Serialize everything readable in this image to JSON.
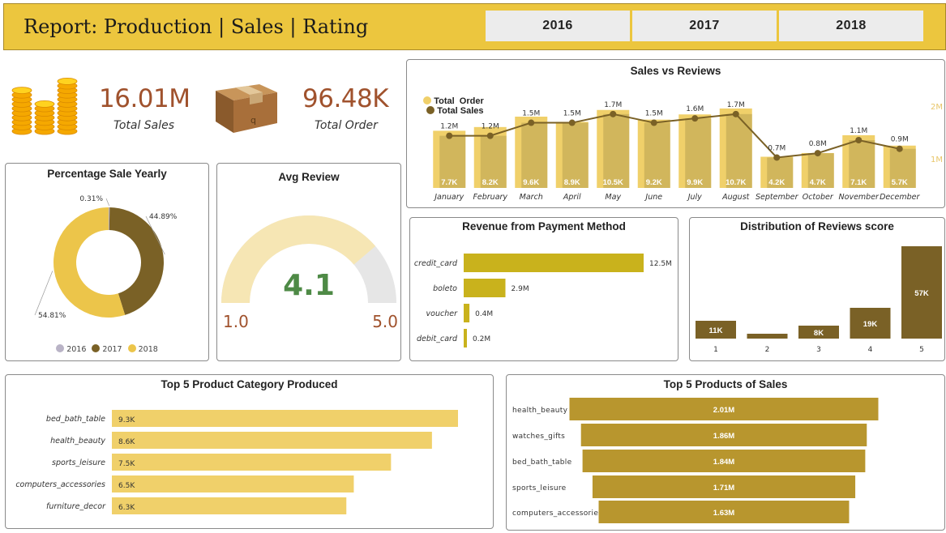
{
  "header": {
    "title": "Report: Production | Sales | Rating",
    "years": [
      "2016",
      "2017",
      "2018"
    ]
  },
  "kpis": {
    "total_sales_value": "16.01M",
    "total_sales_label": "Total Sales",
    "total_order_value": "96.48K",
    "total_order_label": "Total Order"
  },
  "colors": {
    "header_bg": "#ecc63e",
    "kpi_value": "#a0522d",
    "gold_light": "#f0d06a",
    "olive_dark": "#7a6126",
    "mustard": "#c9b21c",
    "gold_mid": "#b8962e",
    "gauge_fill": "#f6e6b4",
    "gauge_rest": "#e6e6e6",
    "gauge_value": "#4e8a46"
  },
  "pie": {
    "title": "Percentage Sale Yearly",
    "legend": [
      "2016",
      "2017",
      "2018"
    ],
    "legend_colors": [
      "#b9b3c6",
      "#7a6126",
      "#ecc54a"
    ]
  },
  "gauge": {
    "title": "Avg Review",
    "value": "4.1",
    "min": "1.0",
    "max": "5.0"
  },
  "sales_reviews": {
    "title": "Sales vs Reviews",
    "legend_order": "Total  Order",
    "legend_sales": "Total Sales",
    "right_axis_ticks": [
      "2M",
      "1M"
    ]
  },
  "payment": {
    "title": "Revenue from Payment Method"
  },
  "reviews_dist": {
    "title": "Distribution of Reviews score"
  },
  "categories_produced": {
    "title": "Top 5 Product Category Produced"
  },
  "products_sales": {
    "title": "Top 5 Products of Sales"
  },
  "chart_data": [
    {
      "id": "pie",
      "type": "pie",
      "title": "Percentage Sale Yearly",
      "labels": [
        "2016",
        "2017",
        "2018"
      ],
      "values": [
        0.31,
        44.89,
        54.81
      ],
      "value_labels": [
        "0.31%",
        "44.89%",
        "54.81%"
      ],
      "legend": "bottom"
    },
    {
      "id": "sales_reviews",
      "type": "bar",
      "title": "Sales vs Reviews",
      "categories": [
        "January",
        "February",
        "March",
        "April",
        "May",
        "June",
        "July",
        "August",
        "September",
        "October",
        "November",
        "December"
      ],
      "series": [
        {
          "name": "Total  Order",
          "type": "bar",
          "values": [
            7.7,
            8.2,
            9.6,
            8.9,
            10.5,
            9.2,
            9.9,
            10.7,
            4.2,
            4.7,
            7.1,
            5.7
          ],
          "labels": [
            "7.7K",
            "8.2K",
            "9.6K",
            "8.9K",
            "10.5K",
            "9.2K",
            "9.9K",
            "10.7K",
            "4.2K",
            "4.7K",
            "7.1K",
            "5.7K"
          ]
        },
        {
          "name": "Total Sales",
          "type": "line",
          "values": [
            1.2,
            1.2,
            1.5,
            1.5,
            1.7,
            1.5,
            1.6,
            1.7,
            0.7,
            0.8,
            1.1,
            0.9
          ],
          "labels": [
            "1.2M",
            "1.2M",
            "1.5M",
            "1.5M",
            "1.7M",
            "1.5M",
            "1.6M",
            "1.7M",
            "0.7M",
            "0.8M",
            "1.1M",
            "0.9M"
          ]
        }
      ],
      "legend": "top-left"
    },
    {
      "id": "payment",
      "type": "bar",
      "title": "Revenue from Payment Method",
      "categories": [
        "credit_card",
        "boleto",
        "voucher",
        "debit_card"
      ],
      "values": [
        12.5,
        2.9,
        0.4,
        0.2
      ],
      "labels": [
        "12.5M",
        "2.9M",
        "0.4M",
        "0.2M"
      ]
    },
    {
      "id": "reviews_dist",
      "type": "bar",
      "title": "Distribution of Reviews score",
      "categories": [
        "1",
        "2",
        "3",
        "4",
        "5"
      ],
      "values": [
        11,
        3,
        8,
        19,
        57
      ],
      "labels": [
        "11K",
        "",
        "8K",
        "19K",
        "57K"
      ]
    },
    {
      "id": "categories_produced",
      "type": "bar",
      "title": "Top 5 Product Category Produced",
      "categories": [
        "bed_bath_table",
        "health_beauty",
        "sports_leisure",
        "computers_accessories",
        "furniture_decor"
      ],
      "values": [
        9.3,
        8.6,
        7.5,
        6.5,
        6.3
      ],
      "labels": [
        "9.3K",
        "8.6K",
        "7.5K",
        "6.5K",
        "6.3K"
      ]
    },
    {
      "id": "products_sales",
      "type": "bar",
      "title": "Top 5 Products of Sales",
      "categories": [
        "health_beauty",
        "watches_gifts",
        "bed_bath_table",
        "sports_leisure",
        "computers_accessories"
      ],
      "values": [
        2.01,
        1.86,
        1.84,
        1.71,
        1.63
      ],
      "labels": [
        "2.01M",
        "1.86M",
        "1.84M",
        "1.71M",
        "1.63M"
      ]
    }
  ]
}
